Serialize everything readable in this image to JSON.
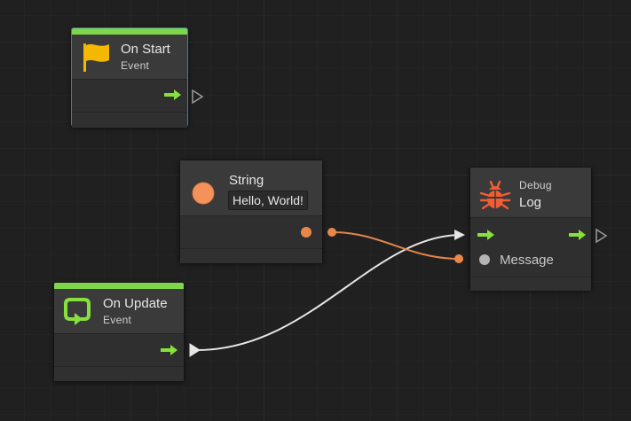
{
  "nodes": {
    "on_start": {
      "title": "On Start",
      "subtitle": "Event"
    },
    "string": {
      "title": "String",
      "value": "Hello, World!"
    },
    "debug_log": {
      "category": "Debug",
      "title": "Log",
      "input_label": "Message"
    },
    "on_update": {
      "title": "On Update",
      "subtitle": "Event"
    }
  },
  "colors": {
    "canvas": "#202020",
    "event_bar": "#7fd64a",
    "flow_arrow": "#86e13c",
    "string_port": "#e8874a",
    "debug_icon": "#f25d35",
    "flag_icon": "#f5b800",
    "selection": "#3a79bb"
  },
  "icons": {
    "on_start": "flag-icon",
    "string": "circle-icon",
    "debug_log": "bug-icon",
    "on_update": "loop-icon"
  }
}
